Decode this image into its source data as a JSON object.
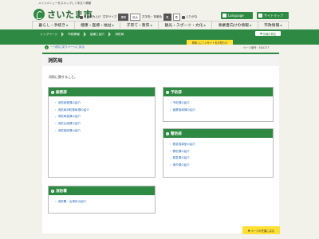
{
  "header": {
    "skip_link": "メインメニューをスキップして本文へ移動",
    "logo_text": "さいたま市",
    "tools": {
      "voice_reading": "音声読み上げ",
      "text_size_label": "文字サイズ",
      "text_size_options": [
        "標準",
        "拡大"
      ],
      "color_label": "文字色・背景色",
      "color_options": [
        "黒",
        "青"
      ],
      "accessibility": "ふりがな"
    },
    "language": "Language",
    "sitemap": "サイトマップ",
    "gnav": [
      "暮らし・手続き",
      "健康・医療・福祉",
      "子育て・教育",
      "観光・スポーツ・文化",
      "事業者向けの情報",
      "市政情報"
    ]
  },
  "band": {
    "breadcrumbs": [
      "トップページ",
      "市政情報",
      "組織と紹介",
      "消防局"
    ],
    "share": "情報の発信",
    "notice": "検索しにくいサイトをお知らせ"
  },
  "sub": {
    "back_link": "一つ前に戻りページに戻る",
    "page_number": "ページ番号：E00177"
  },
  "main": {
    "title": "消防局",
    "intro": "消防に関すること。",
    "panels": {
      "soumu": {
        "title": "総務部",
        "items": [
          "消防総務課の紹介",
          "消防局消防基幹課の紹介",
          "消防局保課の紹介",
          "消防企画課の紹介",
          "消防施設課の紹介"
        ]
      },
      "yobou": {
        "title": "予防部",
        "items": [
          "予防課の紹介",
          "査察指導課の紹介"
        ]
      },
      "keibou": {
        "title": "警防部",
        "items": [
          "救急指導室の紹介",
          "警防課の紹介",
          "救急課の紹介",
          "指令課の紹介"
        ]
      },
      "shobo": {
        "title": "消防署",
        "items": [
          "消防署・出張所の紹介"
        ]
      }
    }
  },
  "footer": {
    "top_button": "ページの先頭に戻る"
  },
  "colors": {
    "brand_green": "#2e8a42",
    "accent_yellow": "#ffe033",
    "link_blue": "#2d6ab8",
    "background": "#f2f1ea"
  }
}
